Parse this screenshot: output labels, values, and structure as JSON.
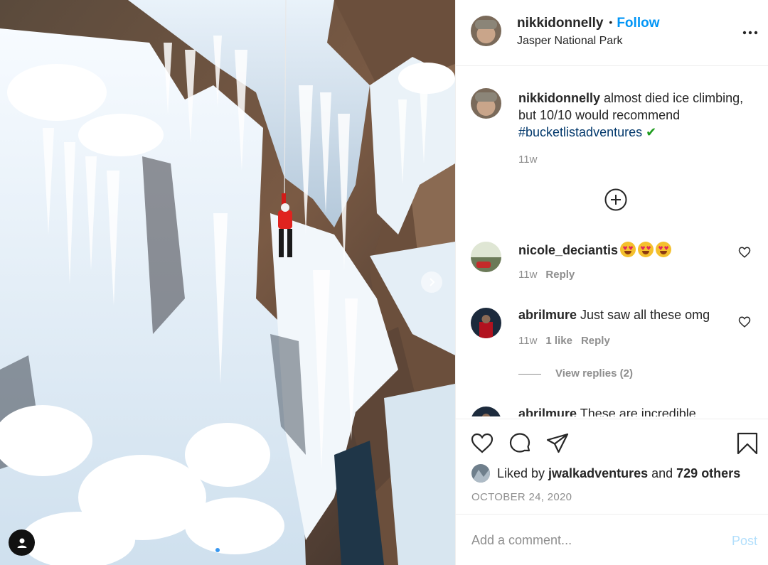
{
  "post": {
    "author": "nikkidonnelly",
    "separator": "•",
    "follow_label": "Follow",
    "location": "Jasper National Park"
  },
  "caption": {
    "username": "nikkidonnelly",
    "text": " almost died ice climbing, but 10/10 would recommend ",
    "hashtag": "#bucketlistadventures",
    "check": "✔",
    "time": "11w"
  },
  "comments": [
    {
      "username": "nicole_deciantis",
      "text": "",
      "time": "11w",
      "likes": "",
      "reply_label": "Reply"
    },
    {
      "username": "abrilmure",
      "text": " Just saw all these omg",
      "time": "11w",
      "likes": "1 like",
      "reply_label": "Reply",
      "view_replies": "View replies (2)"
    },
    {
      "username": "abrilmure",
      "text": " These are incredible"
    }
  ],
  "likes": {
    "prefix": "Liked by ",
    "user": "jwalkadventures",
    "middle": " and ",
    "others": "729 others"
  },
  "date": "OCTOBER 24, 2020",
  "add_comment": {
    "placeholder": "Add a comment...",
    "post_label": "Post"
  },
  "icons": [
    "more-options-icon",
    "load-more-icon",
    "heart-icon",
    "comment-icon",
    "share-icon",
    "bookmark-icon",
    "user-tag-icon",
    "next-arrow-icon"
  ],
  "colors": {
    "follow": "#0095f6",
    "hashtag": "#00376b",
    "muted": "#8e8e8e",
    "post_disabled": "#b2dffc",
    "check": "#1e9c1e"
  }
}
